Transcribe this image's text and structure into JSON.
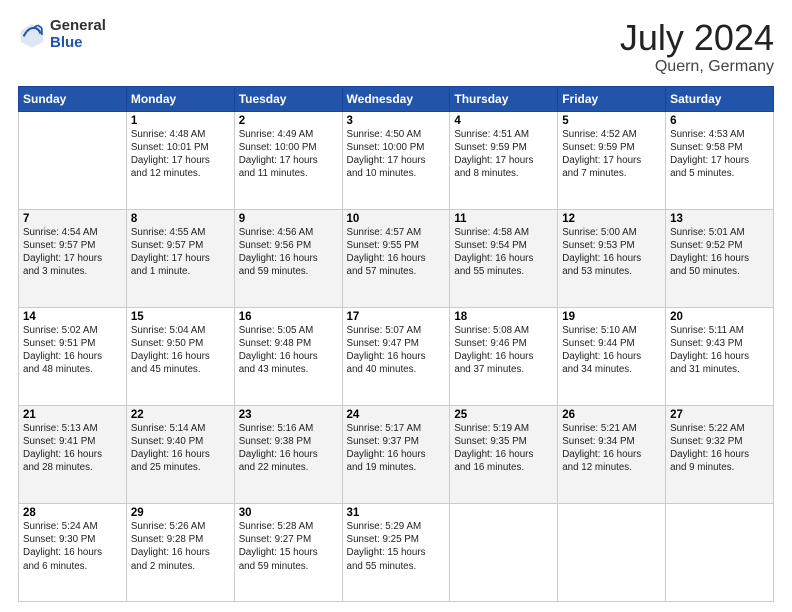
{
  "header": {
    "logo_general": "General",
    "logo_blue": "Blue",
    "month": "July 2024",
    "location": "Quern, Germany"
  },
  "weekdays": [
    "Sunday",
    "Monday",
    "Tuesday",
    "Wednesday",
    "Thursday",
    "Friday",
    "Saturday"
  ],
  "weeks": [
    [
      {
        "day": "",
        "info": ""
      },
      {
        "day": "1",
        "info": "Sunrise: 4:48 AM\nSunset: 10:01 PM\nDaylight: 17 hours\nand 12 minutes."
      },
      {
        "day": "2",
        "info": "Sunrise: 4:49 AM\nSunset: 10:00 PM\nDaylight: 17 hours\nand 11 minutes."
      },
      {
        "day": "3",
        "info": "Sunrise: 4:50 AM\nSunset: 10:00 PM\nDaylight: 17 hours\nand 10 minutes."
      },
      {
        "day": "4",
        "info": "Sunrise: 4:51 AM\nSunset: 9:59 PM\nDaylight: 17 hours\nand 8 minutes."
      },
      {
        "day": "5",
        "info": "Sunrise: 4:52 AM\nSunset: 9:59 PM\nDaylight: 17 hours\nand 7 minutes."
      },
      {
        "day": "6",
        "info": "Sunrise: 4:53 AM\nSunset: 9:58 PM\nDaylight: 17 hours\nand 5 minutes."
      }
    ],
    [
      {
        "day": "7",
        "info": "Sunrise: 4:54 AM\nSunset: 9:57 PM\nDaylight: 17 hours\nand 3 minutes."
      },
      {
        "day": "8",
        "info": "Sunrise: 4:55 AM\nSunset: 9:57 PM\nDaylight: 17 hours\nand 1 minute."
      },
      {
        "day": "9",
        "info": "Sunrise: 4:56 AM\nSunset: 9:56 PM\nDaylight: 16 hours\nand 59 minutes."
      },
      {
        "day": "10",
        "info": "Sunrise: 4:57 AM\nSunset: 9:55 PM\nDaylight: 16 hours\nand 57 minutes."
      },
      {
        "day": "11",
        "info": "Sunrise: 4:58 AM\nSunset: 9:54 PM\nDaylight: 16 hours\nand 55 minutes."
      },
      {
        "day": "12",
        "info": "Sunrise: 5:00 AM\nSunset: 9:53 PM\nDaylight: 16 hours\nand 53 minutes."
      },
      {
        "day": "13",
        "info": "Sunrise: 5:01 AM\nSunset: 9:52 PM\nDaylight: 16 hours\nand 50 minutes."
      }
    ],
    [
      {
        "day": "14",
        "info": "Sunrise: 5:02 AM\nSunset: 9:51 PM\nDaylight: 16 hours\nand 48 minutes."
      },
      {
        "day": "15",
        "info": "Sunrise: 5:04 AM\nSunset: 9:50 PM\nDaylight: 16 hours\nand 45 minutes."
      },
      {
        "day": "16",
        "info": "Sunrise: 5:05 AM\nSunset: 9:48 PM\nDaylight: 16 hours\nand 43 minutes."
      },
      {
        "day": "17",
        "info": "Sunrise: 5:07 AM\nSunset: 9:47 PM\nDaylight: 16 hours\nand 40 minutes."
      },
      {
        "day": "18",
        "info": "Sunrise: 5:08 AM\nSunset: 9:46 PM\nDaylight: 16 hours\nand 37 minutes."
      },
      {
        "day": "19",
        "info": "Sunrise: 5:10 AM\nSunset: 9:44 PM\nDaylight: 16 hours\nand 34 minutes."
      },
      {
        "day": "20",
        "info": "Sunrise: 5:11 AM\nSunset: 9:43 PM\nDaylight: 16 hours\nand 31 minutes."
      }
    ],
    [
      {
        "day": "21",
        "info": "Sunrise: 5:13 AM\nSunset: 9:41 PM\nDaylight: 16 hours\nand 28 minutes."
      },
      {
        "day": "22",
        "info": "Sunrise: 5:14 AM\nSunset: 9:40 PM\nDaylight: 16 hours\nand 25 minutes."
      },
      {
        "day": "23",
        "info": "Sunrise: 5:16 AM\nSunset: 9:38 PM\nDaylight: 16 hours\nand 22 minutes."
      },
      {
        "day": "24",
        "info": "Sunrise: 5:17 AM\nSunset: 9:37 PM\nDaylight: 16 hours\nand 19 minutes."
      },
      {
        "day": "25",
        "info": "Sunrise: 5:19 AM\nSunset: 9:35 PM\nDaylight: 16 hours\nand 16 minutes."
      },
      {
        "day": "26",
        "info": "Sunrise: 5:21 AM\nSunset: 9:34 PM\nDaylight: 16 hours\nand 12 minutes."
      },
      {
        "day": "27",
        "info": "Sunrise: 5:22 AM\nSunset: 9:32 PM\nDaylight: 16 hours\nand 9 minutes."
      }
    ],
    [
      {
        "day": "28",
        "info": "Sunrise: 5:24 AM\nSunset: 9:30 PM\nDaylight: 16 hours\nand 6 minutes."
      },
      {
        "day": "29",
        "info": "Sunrise: 5:26 AM\nSunset: 9:28 PM\nDaylight: 16 hours\nand 2 minutes."
      },
      {
        "day": "30",
        "info": "Sunrise: 5:28 AM\nSunset: 9:27 PM\nDaylight: 15 hours\nand 59 minutes."
      },
      {
        "day": "31",
        "info": "Sunrise: 5:29 AM\nSunset: 9:25 PM\nDaylight: 15 hours\nand 55 minutes."
      },
      {
        "day": "",
        "info": ""
      },
      {
        "day": "",
        "info": ""
      },
      {
        "day": "",
        "info": ""
      }
    ]
  ]
}
